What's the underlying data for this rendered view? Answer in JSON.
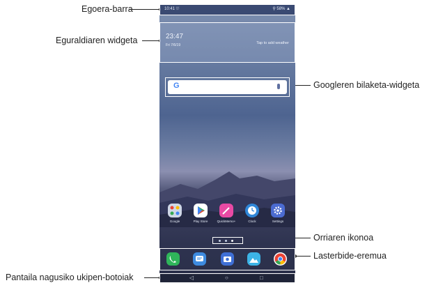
{
  "annotations": {
    "status_bar": "Egoera-barra",
    "weather_widget": "Eguraldiaren widgeta",
    "google_search_widget": "Googleren bilaketa-widgeta",
    "page_icon": "Orriaren ikonoa",
    "shortcut_area": "Lasterbide-eremua",
    "nav_buttons": "Pantaila nagusiko ukipen-botoiak"
  },
  "status_bar": {
    "left_text": "10:41 ⛆",
    "right_text": "⚲ 58% ▲"
  },
  "weather": {
    "time": "23:47",
    "date": "Fri 7/6/19",
    "tap_text": "Tap to add weather"
  },
  "search": {
    "logo": "G",
    "mic_icon": "mic-icon"
  },
  "apps": [
    {
      "name": "Google",
      "color": "#cfd7e6"
    },
    {
      "name": "Play Store",
      "color": "#ffffff"
    },
    {
      "name": "QuickMemo+",
      "color": "#e94aa4"
    },
    {
      "name": "Clock",
      "color": "#2f86d8"
    },
    {
      "name": "Settings",
      "color": "#4b6bd1"
    }
  ],
  "dock": [
    {
      "icon": "phone-icon",
      "color": "#2fb55a"
    },
    {
      "icon": "message-icon",
      "color": "#3e8be0"
    },
    {
      "icon": "camera-icon",
      "color": "#3f6fd6"
    },
    {
      "icon": "gallery-icon",
      "color": "#3cb3e6"
    },
    {
      "icon": "chrome-icon",
      "color": "#ffffff"
    }
  ],
  "navbar": {
    "back": "◁",
    "home": "○",
    "recents": "□"
  },
  "colors": {
    "label_text": "#222222",
    "highlight_border": "#ffffff"
  }
}
